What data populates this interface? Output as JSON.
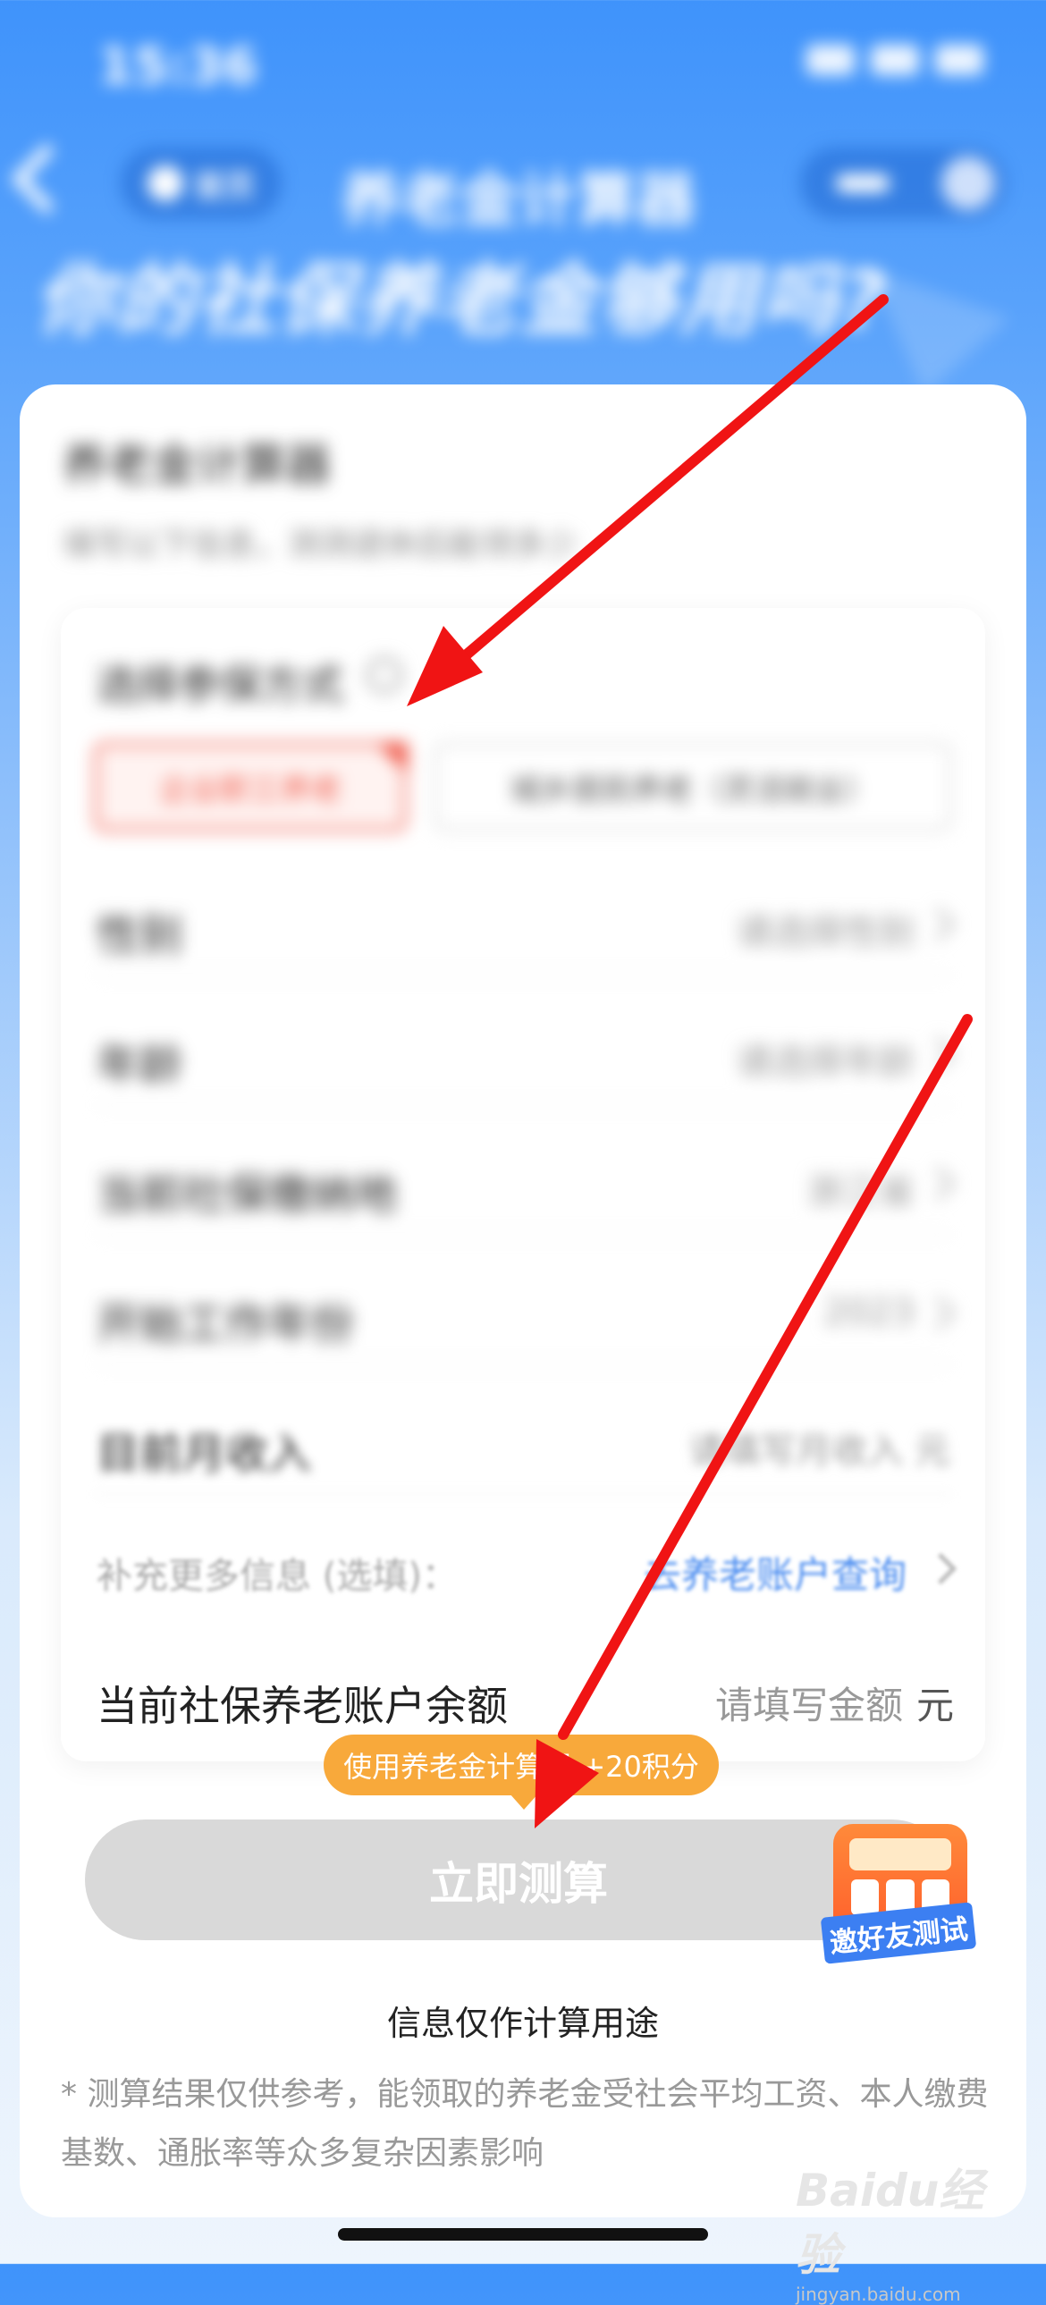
{
  "status_bar": {
    "time": "15:36"
  },
  "nav": {
    "home_label": "首页",
    "title": "养老金计算器"
  },
  "hero": {
    "slogan": "你的社保养老金够用吗?"
  },
  "card": {
    "title": "养老金计算器",
    "subtitle": "填写以下信息，测测退休后能领多少"
  },
  "insurance_type": {
    "label": "选择参保方式",
    "options": [
      "企业职工养老",
      "城乡居民养老（灵活就业）"
    ],
    "selected_index": 0
  },
  "form_rows": [
    {
      "label": "性别",
      "value": "请选择性别"
    },
    {
      "label": "年龄",
      "value": "请选择年龄"
    },
    {
      "label": "当前社保缴纳地",
      "value": "浙江省"
    },
    {
      "label": "开始工作年份",
      "value": "2023"
    },
    {
      "label": "目前月收入",
      "value": "请填写月收入 元"
    }
  ],
  "extra": {
    "label": "补充更多信息 (选填)：",
    "link": "去养老账户查询"
  },
  "balance": {
    "label": "当前社保养老账户余额",
    "placeholder": "请填写金额",
    "unit": "元"
  },
  "promo": {
    "text": "使用养老金计算器 +20积分"
  },
  "calc_button": {
    "label": "立即测算"
  },
  "invite_badge": {
    "label": "邀好友测试"
  },
  "info_note": "信息仅作计算用途",
  "disclaimer": "* 测算结果仅供参考，能领取的养老金受社会平均工资、本人缴费基数、通胀率等众多复杂因素影响",
  "watermark": {
    "brand": "Baidu经验",
    "url": "jingyan.baidu.com"
  },
  "colors": {
    "primary_blue": "#3f93fb",
    "accent_red": "#f05a4a",
    "promo_orange": "#f8a93b",
    "arrow_red": "#f01414"
  }
}
